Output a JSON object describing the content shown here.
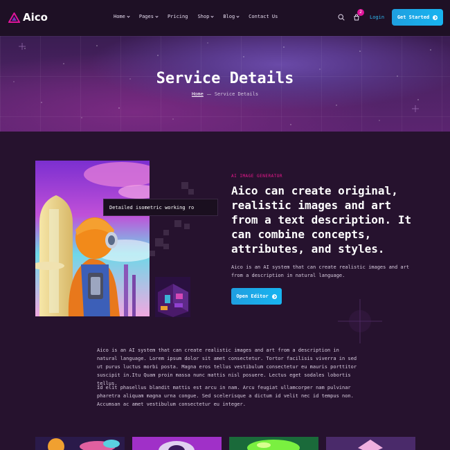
{
  "header": {
    "logo": "Aico",
    "nav": [
      {
        "label": "Home",
        "dropdown": true
      },
      {
        "label": "Pages",
        "dropdown": true
      },
      {
        "label": "Pricing",
        "dropdown": false
      },
      {
        "label": "Shop",
        "dropdown": true
      },
      {
        "label": "Blog",
        "dropdown": true
      },
      {
        "label": "Contact Us",
        "dropdown": false
      }
    ],
    "cart_count": "2",
    "login": "Login",
    "cta": "Get Started"
  },
  "hero": {
    "title": "Service Details",
    "breadcrumb_home": "Home",
    "breadcrumb_current": "Service Details"
  },
  "generator": {
    "prompt_text": "Detailed isometric working ro",
    "eyebrow": "AI IMAGE GENERATOR",
    "headline": "Aico can create original, realistic images and art from a text description. It can combine concepts, attributes, and styles.",
    "description": "Aico is an AI system that can create realistic images and art from a description in natural language.",
    "button": "Open Editor"
  },
  "body": {
    "paragraph_1": "Aico is an AI system that can create realistic images and art from a description in natural language. Lorem ipsum dolor sit amet consectetur. Tortor facilisis viverra in sed ut purus luctus morbi posta. Magna eros tellus vestibulum consectetur eu mauris porttitor suscipit in.Itu Quam proin massa nunc mattis nisl posuere. Lectus eget sodales lobortis tellus.",
    "paragraph_2": "Id elit phasellus blandit mattis est arcu in nam. Arcu feugiat ullamcorper nam pulvinar pharetra aliquam magna urna congue. Sed scelerisque a dictum id velit nec id tempus non. Accumsan ac amet vestibulum consectetur eu integer."
  },
  "colors": {
    "accent": "#18b4f0",
    "eyebrow": "#f01890",
    "background": "#26122e"
  }
}
